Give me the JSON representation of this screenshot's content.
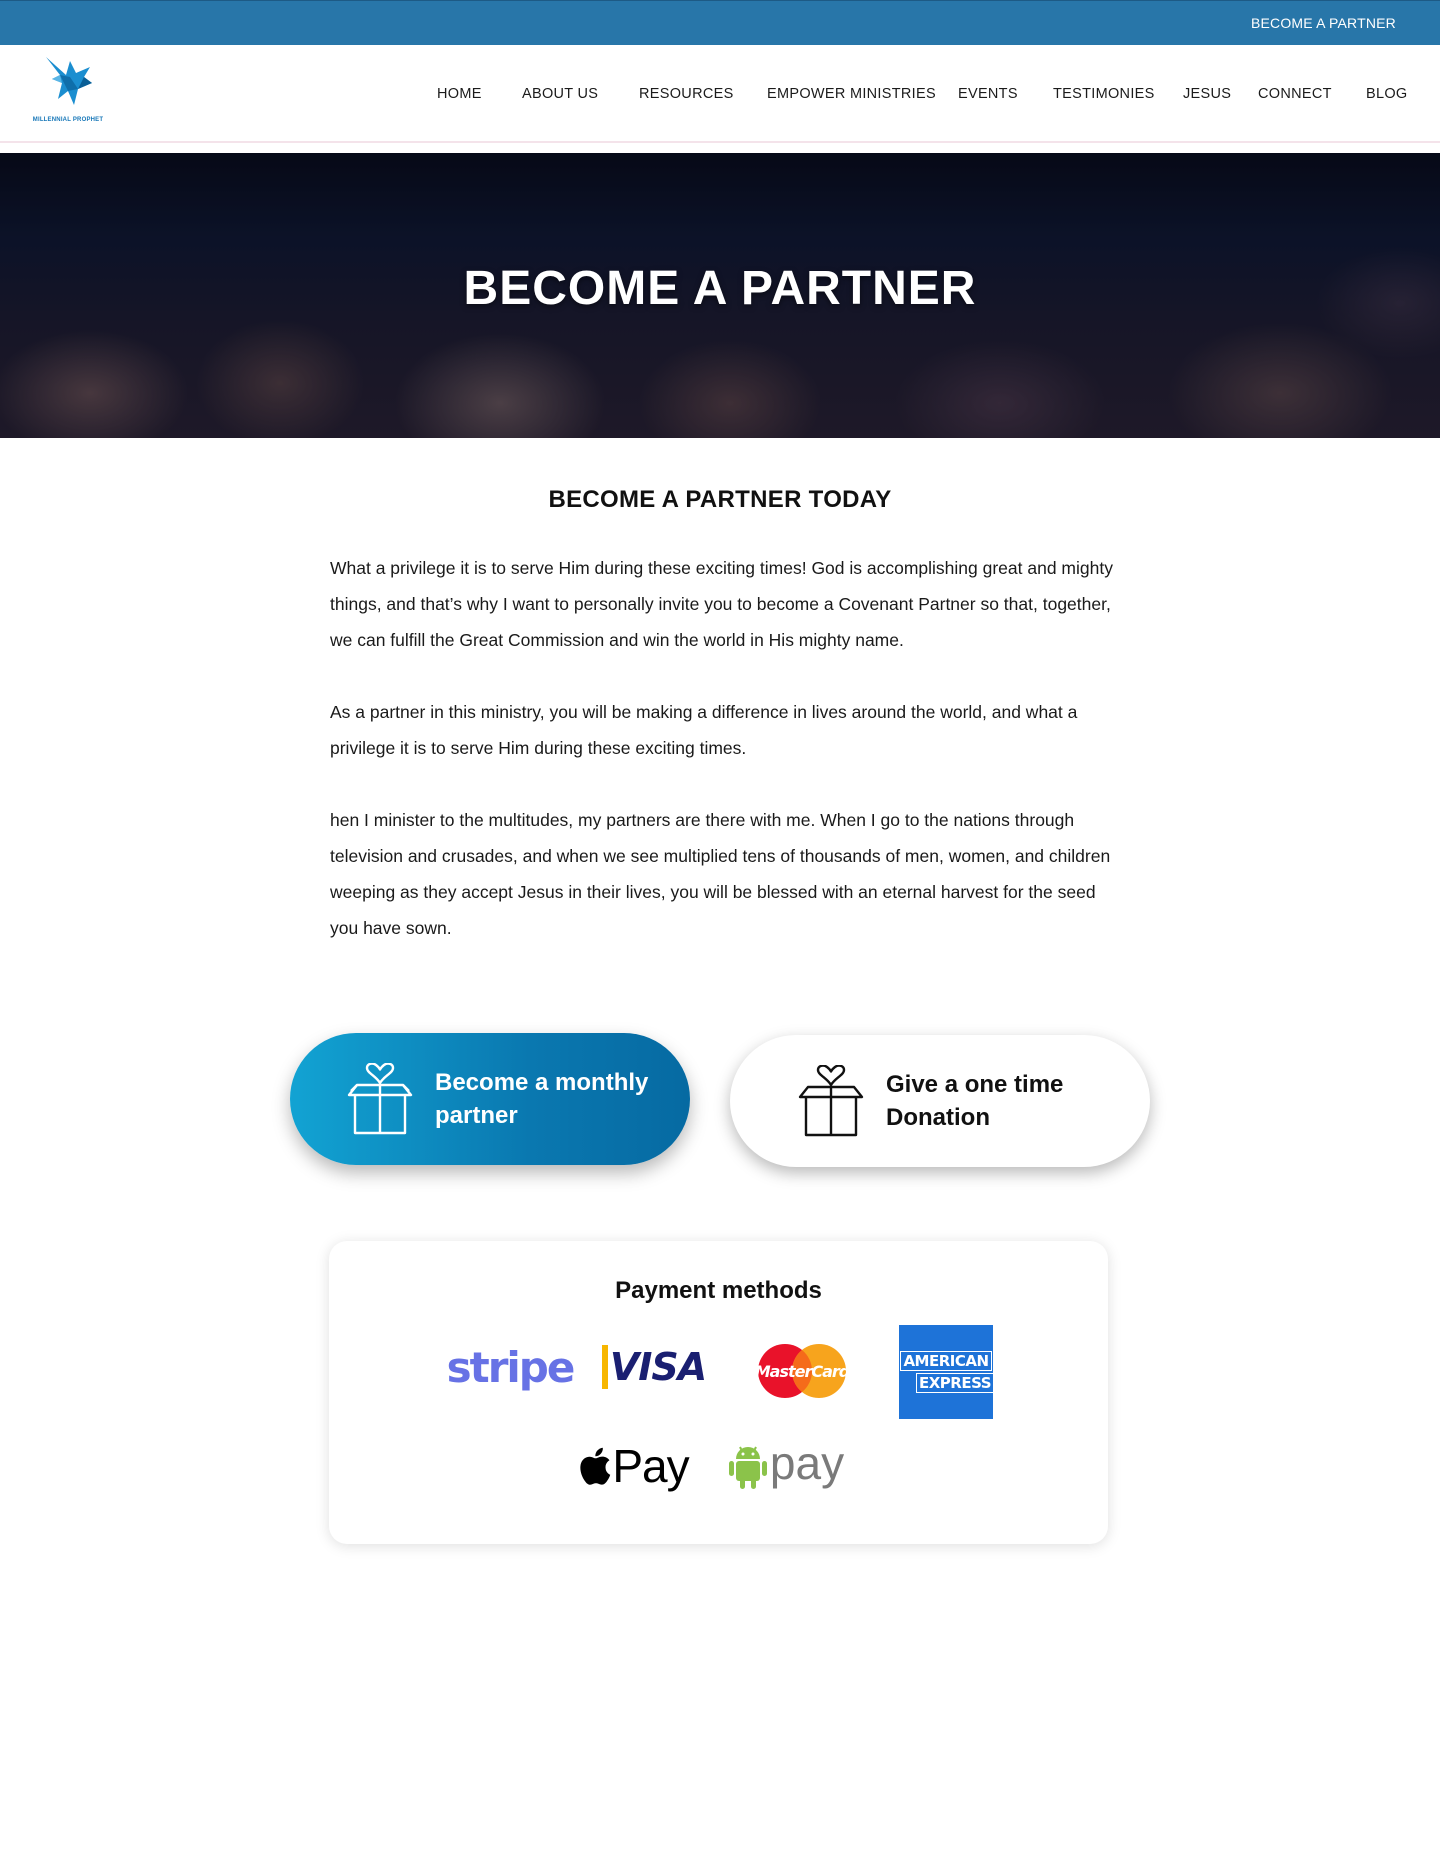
{
  "topbar": {
    "link": "BECOME A PARTNER"
  },
  "brand": {
    "logo_text": "MILLENNIAL PROPHET",
    "color": "#1777b8"
  },
  "nav": {
    "items": [
      "HOME",
      "ABOUT US",
      "RESOURCES",
      "EMPOWER MINISTRIES",
      "EVENTS",
      "TESTIMONIES",
      "JESUS",
      "CONNECT",
      "BLOG"
    ]
  },
  "hero": {
    "title": "BECOME A PARTNER"
  },
  "main": {
    "heading": "BECOME A PARTNER TODAY",
    "paragraphs": [
      "What a privilege it is to serve Him during these exciting times! God is accomplishing great and mighty things, and that’s why I want to personally invite you to become a Covenant Partner so that, together, we can fulfill the Great Commission and win the world in His mighty name.",
      "As a partner in this ministry, you will be making a difference in lives around the world, and what a privilege it is to serve Him during these exciting times.",
      "hen I minister to the multitudes, my partners are there with me. When I go to the nations through television and crusades, and when we see multiplied tens of thousands of men, women, and children weeping as they accept Jesus in their lives, you will be blessed with an eternal harvest for the seed you have sown."
    ]
  },
  "actions": {
    "monthly_label": "Become a monthly partner",
    "once_label": "Give a one time Donation",
    "monthly_icon": "gift-box-heart-icon",
    "once_icon": "gift-box-heart-icon"
  },
  "payment": {
    "title": "Payment methods",
    "methods": {
      "stripe": "stripe",
      "visa": "VISA",
      "mastercard": "MasterCard",
      "amex_line1": "AMERICAN",
      "amex_line2": "EXPRESS",
      "apple_pay": "Pay",
      "android_pay": "pay"
    }
  },
  "colors": {
    "topbar": "#2876a9",
    "button_gradient_start": "#12a3d3",
    "button_gradient_end": "#066aa2",
    "stripe": "#6772e5",
    "visa": "#1a1f71",
    "amex": "#1e73d8",
    "android": "#8bc34a"
  }
}
